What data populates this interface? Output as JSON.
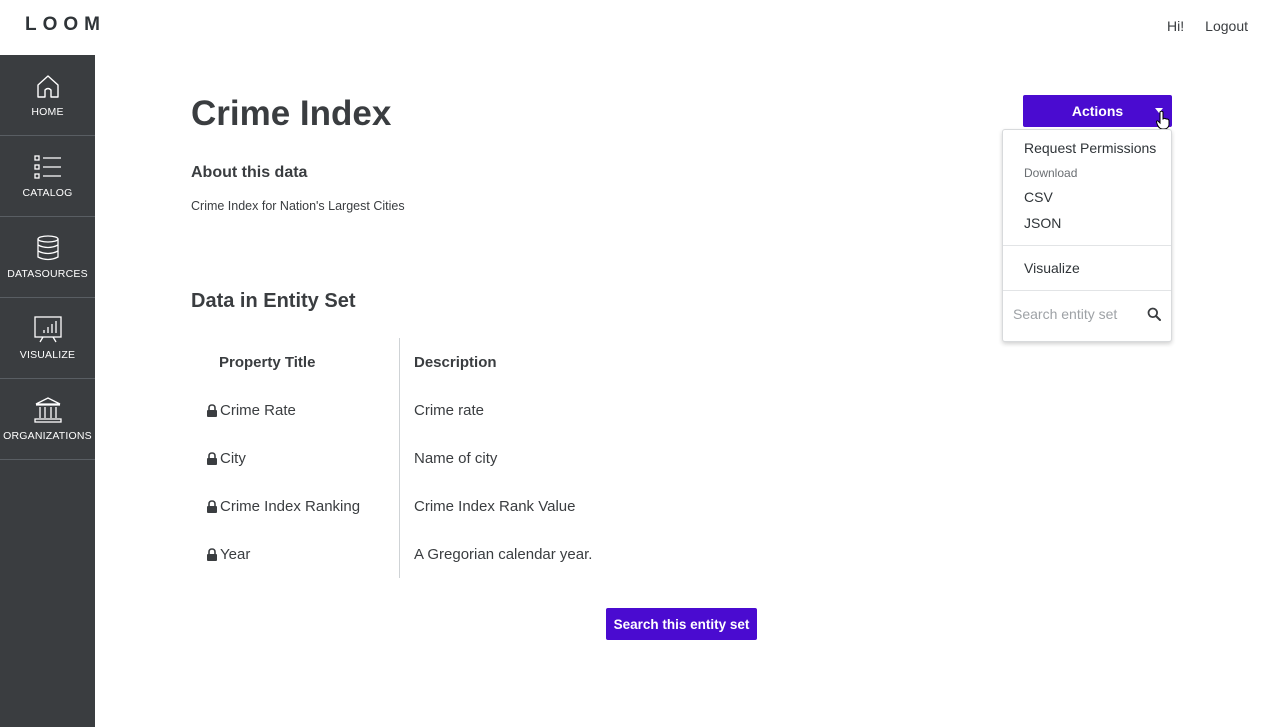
{
  "brand": {
    "logo": "LOOM"
  },
  "header": {
    "greeting": "Hi!",
    "logout": "Logout"
  },
  "sidebar": {
    "items": [
      {
        "label": "HOME",
        "icon": "home-icon"
      },
      {
        "label": "CATALOG",
        "icon": "catalog-icon"
      },
      {
        "label": "DATASOURCES",
        "icon": "database-icon"
      },
      {
        "label": "VISUALIZE",
        "icon": "chart-icon"
      },
      {
        "label": "ORGANIZATIONS",
        "icon": "organization-icon"
      }
    ]
  },
  "main": {
    "title": "Crime Index",
    "about_heading": "About this data",
    "about_text": "Crime Index for Nation's Largest Cities",
    "section_heading": "Data in Entity Set",
    "table": {
      "headers": [
        "Property Title",
        "Description"
      ],
      "rows": [
        {
          "title": "Crime Rate",
          "description": "Crime rate"
        },
        {
          "title": "City",
          "description": "Name of city"
        },
        {
          "title": "Crime Index Ranking",
          "description": "Crime Index Rank Value"
        },
        {
          "title": "Year",
          "description": "A Gregorian calendar year."
        }
      ]
    },
    "search_button": "Search this entity set"
  },
  "actions": {
    "label": "Actions",
    "menu": {
      "request_permissions": "Request Permissions",
      "download_header": "Download",
      "csv": "CSV",
      "json": "JSON",
      "visualize": "Visualize",
      "search_placeholder": "Search entity set"
    }
  },
  "colors": {
    "accent": "#4a0bd0",
    "sidebar": "#3a3d40"
  }
}
